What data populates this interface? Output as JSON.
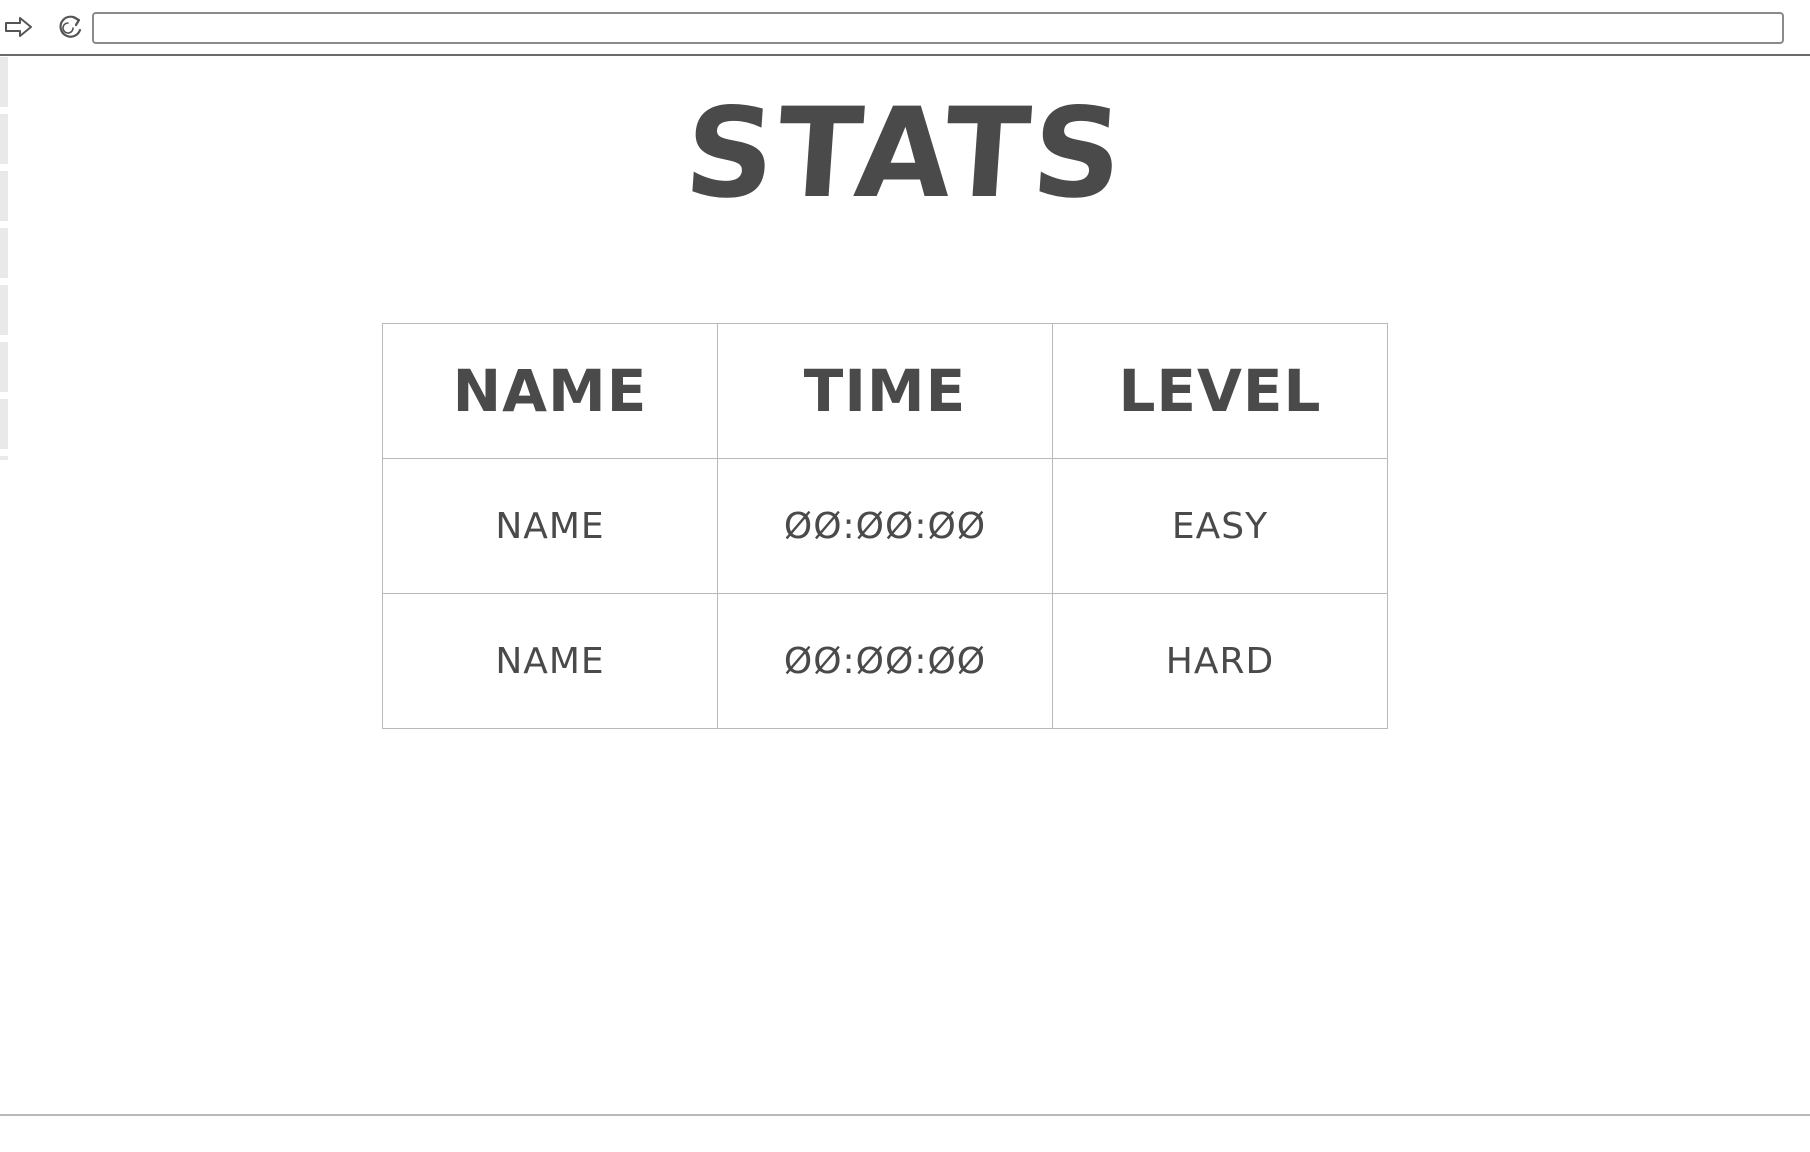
{
  "toolbar": {
    "url_value": "",
    "forward_icon": "arrow-right-icon",
    "reload_icon": "reload-icon"
  },
  "page": {
    "title": "STATS"
  },
  "stats_table": {
    "headers": [
      "NAME",
      "TIME",
      "LEVEL"
    ],
    "rows": [
      [
        "NAME",
        "ØØ:ØØ:ØØ",
        "EASY"
      ],
      [
        "NAME",
        "ØØ:ØØ:ØØ",
        "HARD"
      ]
    ]
  },
  "colors": {
    "text": "#4a4a4a",
    "border": "#b9b9b9",
    "toolbar_rule": "#6a6a6a",
    "accent": "#9cc7ee"
  }
}
